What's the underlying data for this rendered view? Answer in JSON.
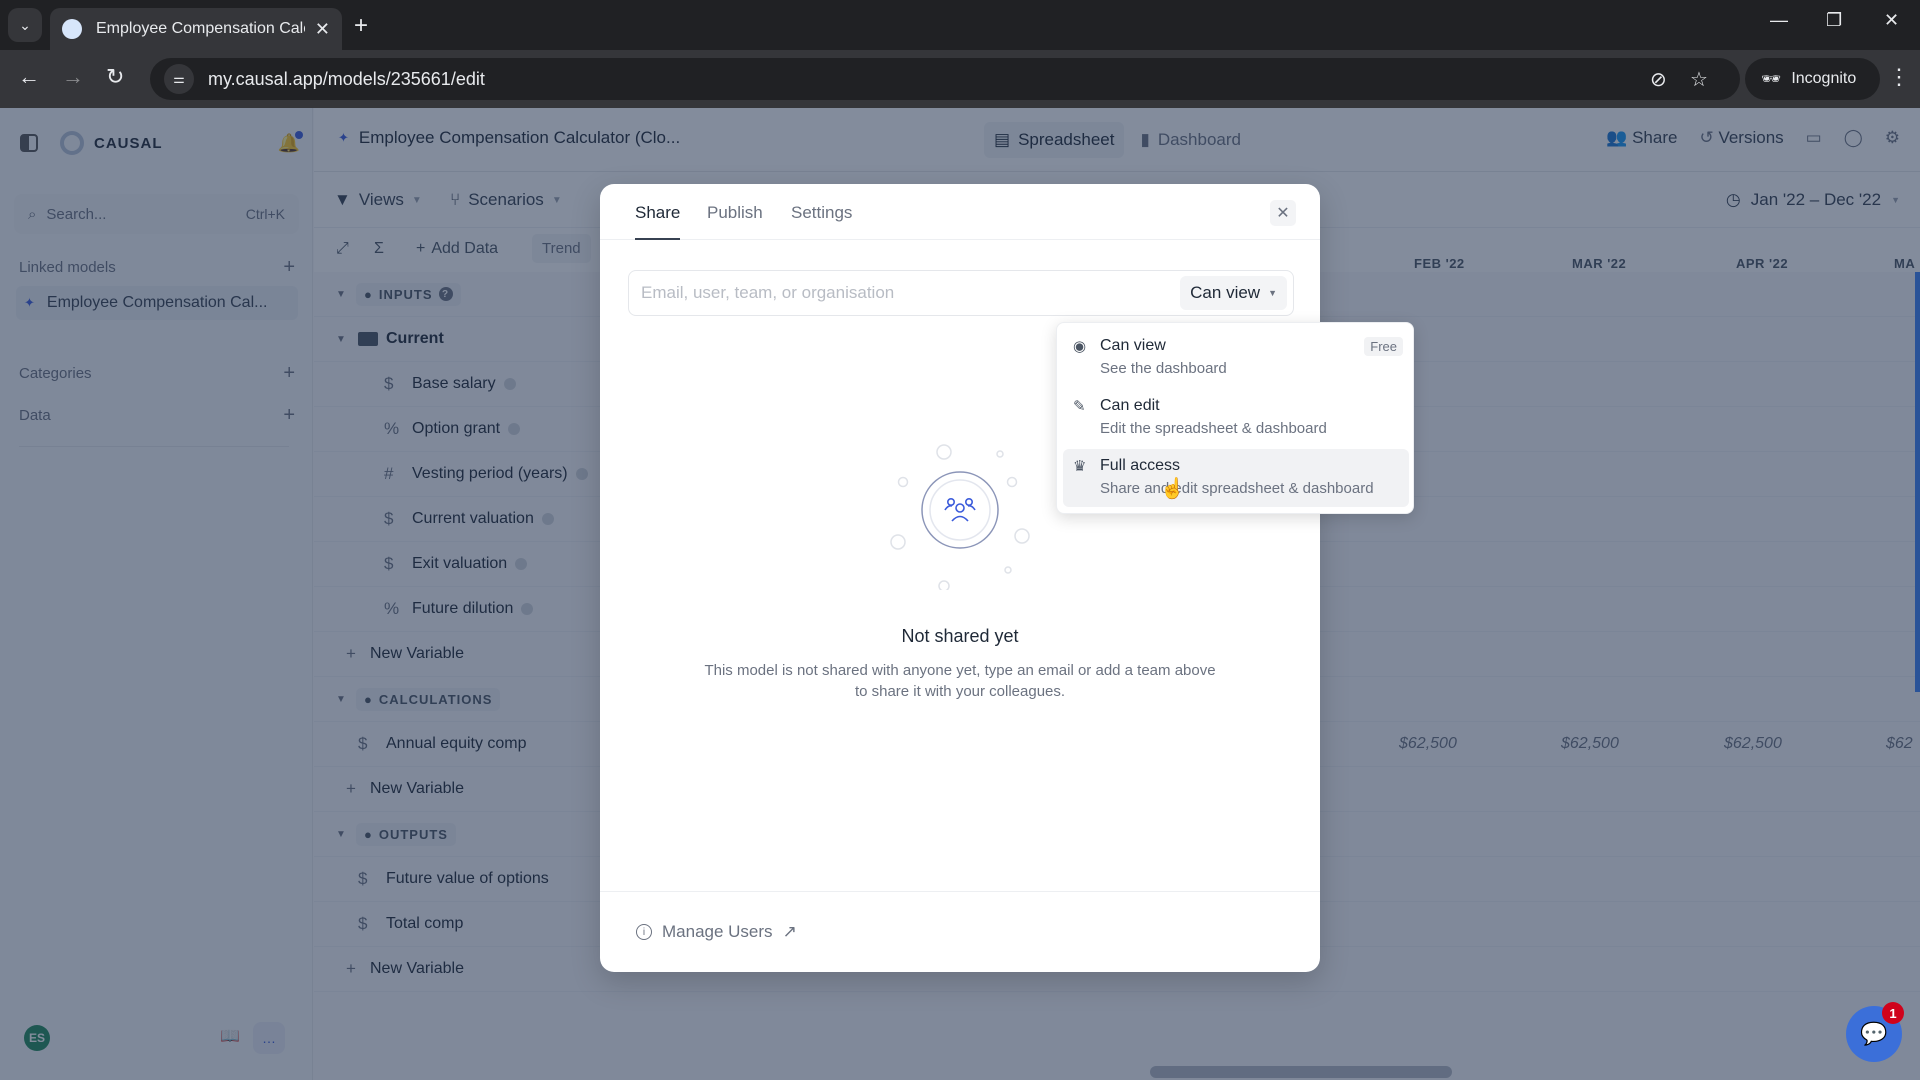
{
  "browser": {
    "tab_title": "Employee Compensation Calcul",
    "url": "my.causal.app/models/235661/edit",
    "incognito_label": "Incognito"
  },
  "sidebar": {
    "brand": "CAUSAL",
    "search_placeholder": "Search...",
    "search_shortcut": "Ctrl+K",
    "linked_models_label": "Linked models",
    "linked_model_item": "Employee Compensation Cal...",
    "categories_label": "Categories",
    "data_label": "Data",
    "user_initials": "ES"
  },
  "header": {
    "model_title": "Employee Compensation Calculator (Clo...",
    "view_tabs": [
      {
        "label": "Spreadsheet",
        "active": true
      },
      {
        "label": "Dashboard",
        "active": false
      }
    ],
    "share_label": "Share",
    "versions_label": "Versions"
  },
  "controls": {
    "views_label": "Views",
    "scenarios_label": "Scenarios",
    "date_range": "Jan '22 – Dec '22",
    "add_data_label": "Add Data",
    "trend_label": "Trend"
  },
  "columns": [
    "FEB '22",
    "MAR '22",
    "APR '22",
    "MA"
  ],
  "groups": {
    "inputs": "INPUTS",
    "folder": "Current",
    "calculations": "CALCULATIONS",
    "outputs": "OUTPUTS"
  },
  "inputs": [
    {
      "icon": "$",
      "label": "Base salary"
    },
    {
      "icon": "%",
      "label": "Option grant"
    },
    {
      "icon": "#",
      "label": "Vesting period (years)"
    },
    {
      "icon": "$",
      "label": "Current valuation"
    },
    {
      "icon": "$",
      "label": "Exit valuation"
    },
    {
      "icon": "%",
      "label": "Future dilution"
    }
  ],
  "calculations": [
    {
      "icon": "$",
      "label": "Annual equity comp",
      "values": [
        "$62,500",
        "$62,500",
        "$62,500",
        "$62"
      ]
    }
  ],
  "outputs": [
    {
      "icon": "$",
      "label": "Future value of options"
    },
    {
      "icon": "$",
      "label": "Total comp"
    }
  ],
  "new_variable_label": "New Variable",
  "modal": {
    "tabs": [
      {
        "label": "Share",
        "active": true
      },
      {
        "label": "Publish",
        "active": false
      },
      {
        "label": "Settings",
        "active": false
      }
    ],
    "input_placeholder": "Email, user, team, or organisation",
    "input_value": "",
    "permission_selected": "Can view",
    "empty_title": "Not shared yet",
    "empty_description": "This model is not shared with anyone yet, type an email or add a team above to share it with your colleagues.",
    "manage_users_label": "Manage Users"
  },
  "permission_options": [
    {
      "icon": "eye-icon",
      "title": "Can view",
      "description": "See the dashboard",
      "badge": "Free",
      "hovered": false
    },
    {
      "icon": "pencil-icon",
      "title": "Can edit",
      "description": "Edit the spreadsheet & dashboard",
      "badge": null,
      "hovered": false
    },
    {
      "icon": "crown-icon",
      "title": "Full access",
      "description": "Share and edit spreadsheet & dashboard",
      "badge": null,
      "hovered": true
    }
  ],
  "chat_widget": {
    "badge_count": "1"
  },
  "colors": {
    "accent": "#3b5bdb",
    "chat_fab": "#3b6fd9",
    "badge_red": "#d0021b",
    "avatar_green": "#1f8a5b"
  }
}
